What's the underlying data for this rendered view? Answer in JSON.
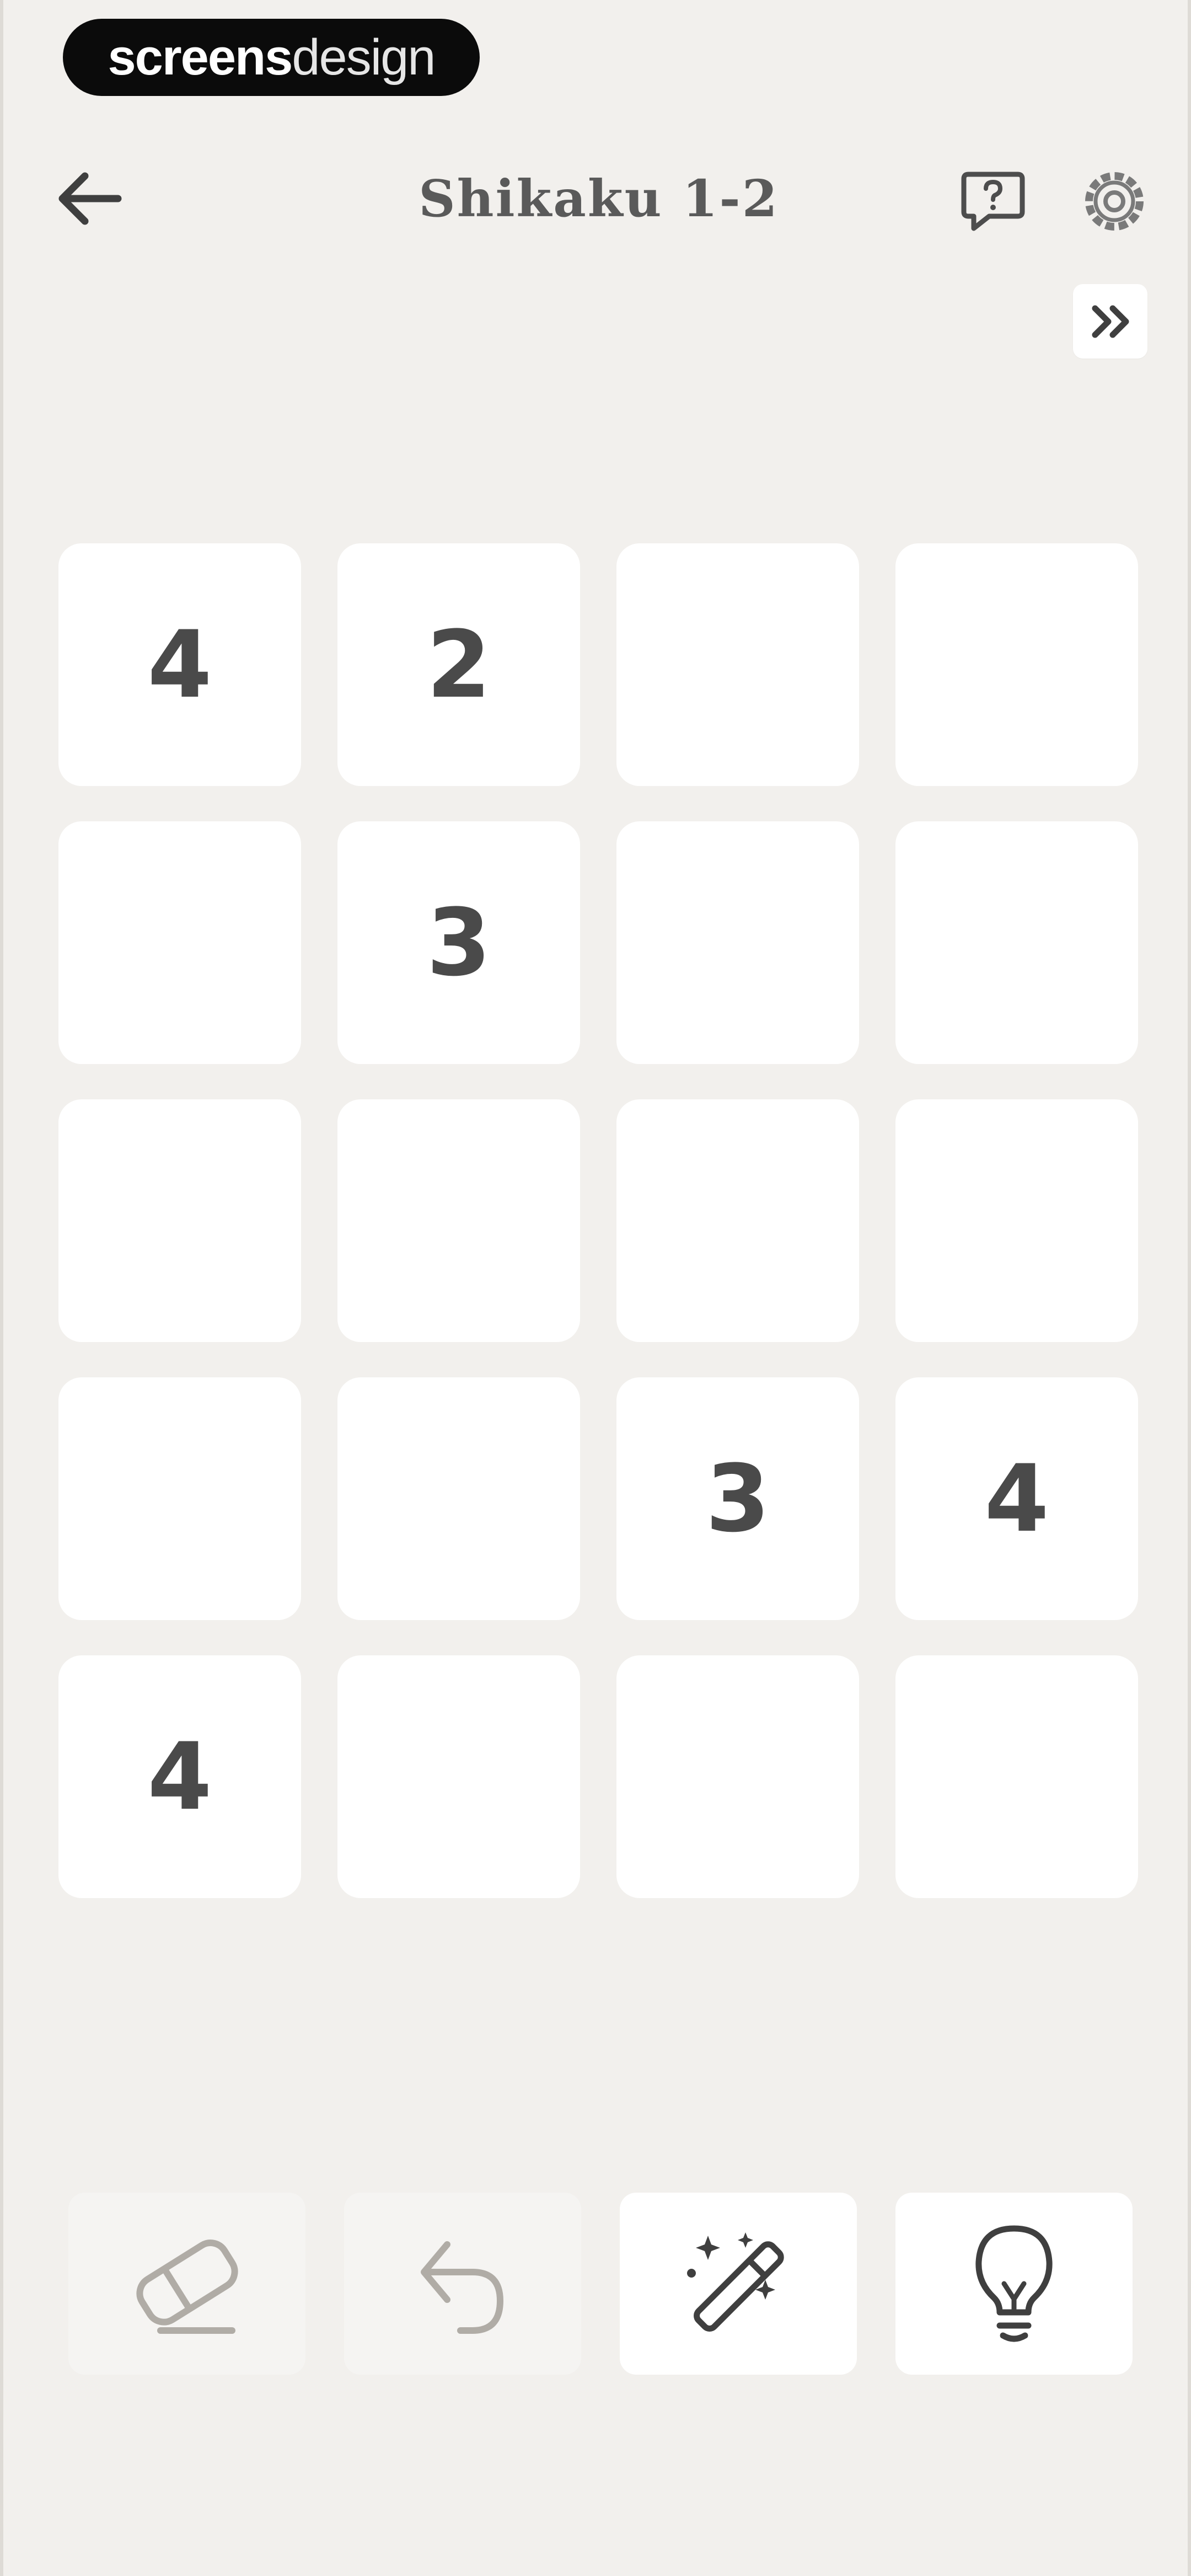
{
  "watermark": {
    "part1": "screens",
    "part2": "design"
  },
  "header": {
    "title": "Shikaku 1-2",
    "back_icon": "arrow-left-icon",
    "help_icon": "help-chat-icon",
    "settings_icon": "gear-icon",
    "skip_icon": "double-chevron-right-icon"
  },
  "grid": {
    "rows": 5,
    "cols": 4,
    "cells": [
      [
        "4",
        "2",
        "",
        ""
      ],
      [
        "",
        "3",
        "",
        ""
      ],
      [
        "",
        "",
        "",
        ""
      ],
      [
        "",
        "",
        "3",
        "4"
      ],
      [
        "4",
        "",
        "",
        ""
      ]
    ]
  },
  "toolbar": {
    "tools": [
      {
        "name": "eraser",
        "icon": "eraser-icon",
        "enabled": false
      },
      {
        "name": "undo",
        "icon": "undo-icon",
        "enabled": false
      },
      {
        "name": "auto-solve",
        "icon": "magic-wand-icon",
        "enabled": true
      },
      {
        "name": "hint",
        "icon": "lightbulb-icon",
        "enabled": true
      }
    ]
  },
  "colors": {
    "background": "#f2f0ed",
    "cell": "#ffffff",
    "number": "#4a4a4a",
    "title": "#5a5a5a",
    "icon_active": "#3f3f3f",
    "icon_disabled": "#b0aca6"
  }
}
